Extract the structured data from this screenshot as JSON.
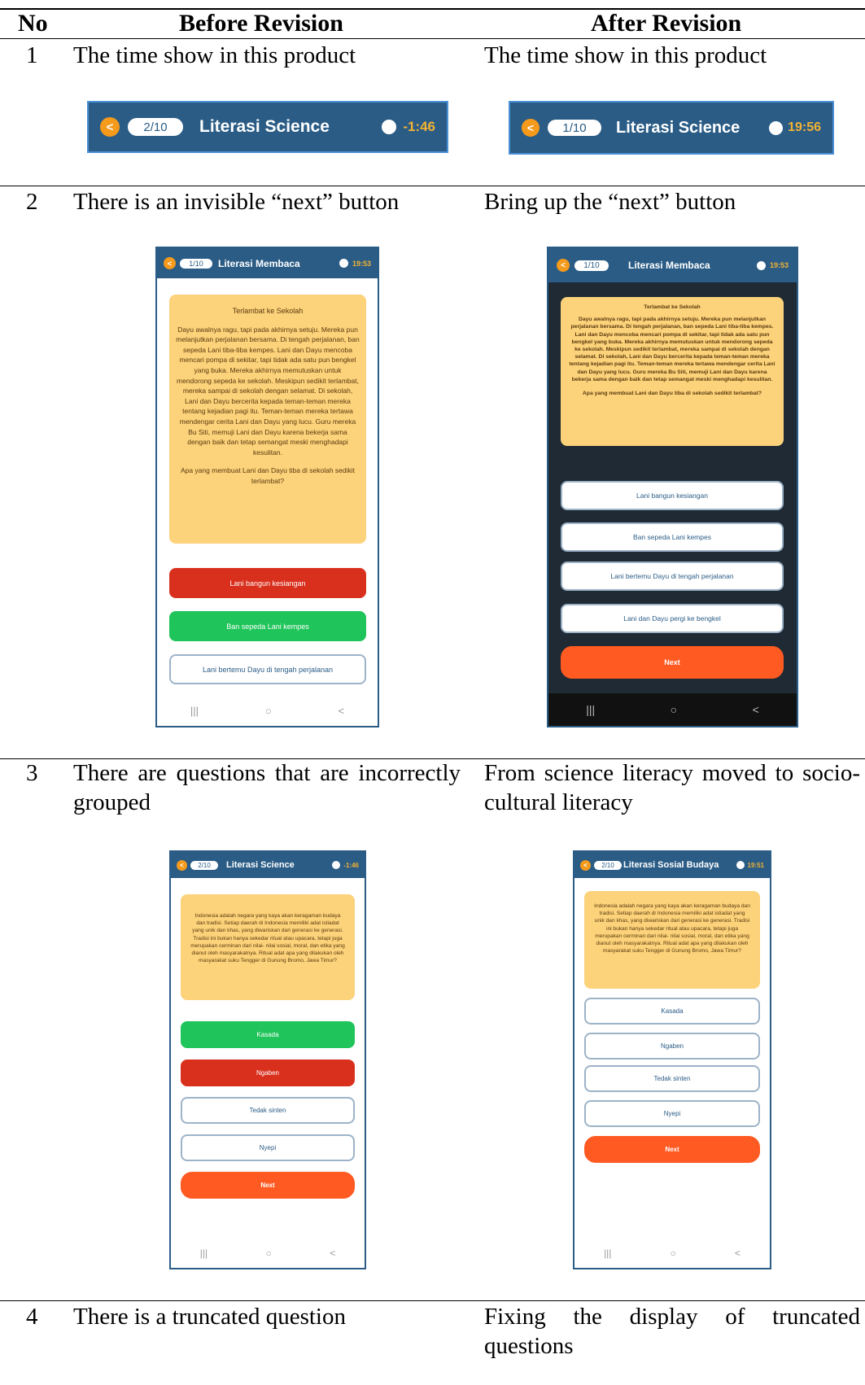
{
  "headers": {
    "no": "No",
    "before": "Before Revision",
    "after": "After Revision"
  },
  "rows": [
    {
      "no": "1",
      "before": "The time show in this product",
      "after": "The time show in this product"
    },
    {
      "no": "2",
      "before": "There is an invisible “next” button",
      "after": "Bring up the “next” button"
    },
    {
      "no": "3",
      "before": "There are questions that are incorrectly grouped",
      "after": "From science literacy moved to socio-cultural literacy"
    },
    {
      "no": "4",
      "before": "There is a truncated question",
      "after": "Fixing the display of truncated questions"
    }
  ],
  "row1": {
    "before_bar": {
      "back": "<",
      "progress": "2/10",
      "title": "Literasi Science",
      "timer": "-1:46"
    },
    "after_bar": {
      "back": "<",
      "progress": "1/10",
      "title": "Literasi Science",
      "timer": "19:56"
    }
  },
  "row2": {
    "before": {
      "bar": {
        "back": "<",
        "progress": "1/10",
        "title": "Literasi Membaca",
        "timer": "19:53"
      },
      "story_title": "Terlambat ke Sekolah",
      "story": "Dayu awalnya ragu, tapi pada akhirnya setuju. Mereka pun melanjutkan perjalanan bersama. Di tengah perjalanan, ban sepeda Lani tiba-tiba kempes. Lani dan Dayu mencoba mencari pompa di sekitar, tapi tidak ada satu pun bengkel yang buka. Mereka akhirnya memutuskan untuk mendorong sepeda ke sekolah. Meskipun sedikit terlambat, mereka sampai di sekolah dengan selamat. Di sekolah, Lani dan Dayu bercerita kepada teman-teman mereka tentang kejadian pagi itu. Teman-teman mereka tertawa mendengar cerita Lani dan Dayu yang lucu. Guru mereka Bu Siti, memuji Lani dan Dayu karena bekerja sama dengan baik dan tetap semangat meski menghadapi kesulitan.",
      "question": "Apa yang membuat Lani dan Dayu tiba di sekolah sedikit terlambat?",
      "options": [
        "Lani bangun kesiangan",
        "Ban sepeda Lani kempes",
        "Lani bertemu Dayu di tengah perjalanan"
      ],
      "nav": [
        "|||",
        "○",
        "<"
      ]
    },
    "after": {
      "bar": {
        "back": "<",
        "progress": "1/10",
        "title": "Literasi Membaca",
        "timer": "19:53"
      },
      "story_title": "Terlambat ke Sekolah",
      "story": "Dayu awalnya ragu, tapi pada akhirnya setuju. Mereka pun melanjutkan perjalanan bersama. Di tengah perjalanan, ban sepeda Lani tiba-tiba kempes. Lani dan Dayu mencoba mencari pompa di sekitar, tapi tidak ada satu pun bengkel yang buka. Mereka akhirnya memutuskan untuk mendorong sepeda ke sekolah. Meskipun sedikit terlambat, mereka sampai di sekolah dengan selamat. Di sekolah, Lani dan Dayu bercerita kepada teman-teman mereka tentang kejadian pagi itu. Teman-teman mereka tertawa mendengar cerita Lani dan Dayu yang lucu. Guru mereka Bu Siti, memuji Lani dan Dayu karena bekerja sama dengan baik dan tetap semangat meski menghadapi kesulitan.",
      "question": "Apa yang membuat Lani dan Dayu tiba di sekolah sedikit terlambat?",
      "options": [
        "Lani bangun kesiangan",
        "Ban sepeda Lani kempes",
        "Lani bertemu Dayu di tengah perjalanan",
        "Lani dan Dayu pergi ke bengkel"
      ],
      "next": "Next",
      "nav": [
        "|||",
        "○",
        "<"
      ]
    }
  },
  "row3": {
    "before": {
      "bar": {
        "back": "<",
        "progress": "2/10",
        "title": "Literasi Science",
        "timer": "-1:46"
      },
      "story": "Indonesia adalah negara yang kaya akan keragaman budaya dan tradisi. Setiap daerah di Indonesia memiliki adat istiadat yang unik dan khas, yang diwariskan dari generasi ke generasi. Tradisi ini bukan hanya sekedar ritual atau upacara, tetapi juga merupakan cerminan dari nilai- nilai sosial, moral, dan etika yang dianut oleh masyarakatnya. Ritual adat apa yang dilakukan oleh masyarakat suku Tengger di Gunung Bromo, Jawa Timur?",
      "options": [
        "Kasada",
        "Ngaben",
        "Tedak sinten",
        "Nyepi"
      ],
      "next": "Next",
      "nav": [
        "|||",
        "○",
        "<"
      ]
    },
    "after": {
      "bar": {
        "back": "<",
        "progress": "2/10",
        "title": "Literasi Sosial Budaya",
        "timer": "19:51"
      },
      "story": "Indonesia adalah negara yang kaya akan keragaman budaya dan tradisi. Setiap daerah di Indonesia memiliki adat istiadat yang unik dan khas, yang diwariskan dari generasi ke generasi. Tradisi ini bukan hanya sekedar ritual atau upacara, tetapi juga merupakan cerminan dari nilai- nilai sosial, moral, dan etika yang dianut oleh masyarakatnya. Ritual adat apa yang dilakukan oleh masyarakat suku Tengger di Gunung Bromo, Jawa Timur?",
      "options": [
        "Kasada",
        "Ngaben",
        "Tedak sinten",
        "Nyepi"
      ],
      "next": "Next",
      "nav": [
        "|||",
        "○",
        "<"
      ]
    }
  }
}
